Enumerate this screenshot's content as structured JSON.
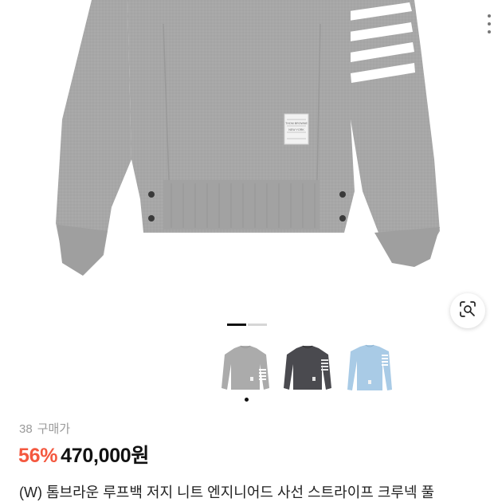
{
  "product": {
    "purchase_count": "38",
    "purchase_label": "구매가",
    "discount": "56%",
    "price": "470,000원",
    "title": "(W) 톰브라운 루프백 저지 니트 엔지니어드 사선 스트라이프 크루넥 풀"
  },
  "gallery": {
    "pages": 2,
    "active_page": 1,
    "label_lines": [
      "THOM BROWNE",
      "NEW YORK"
    ]
  },
  "options": [
    {
      "name": "light grey",
      "color": "#a9a9a9",
      "selected": true
    },
    {
      "name": "charcoal",
      "color": "#48484d",
      "selected": false
    },
    {
      "name": "light blue",
      "color": "#a9cbe6",
      "selected": false
    }
  ],
  "colors": {
    "accent_discount": "#f4583f",
    "sweater_grey": "#a5a5a5"
  },
  "icons": {
    "image_search": "lens-search-icon",
    "more": "more-vertical-icon"
  }
}
